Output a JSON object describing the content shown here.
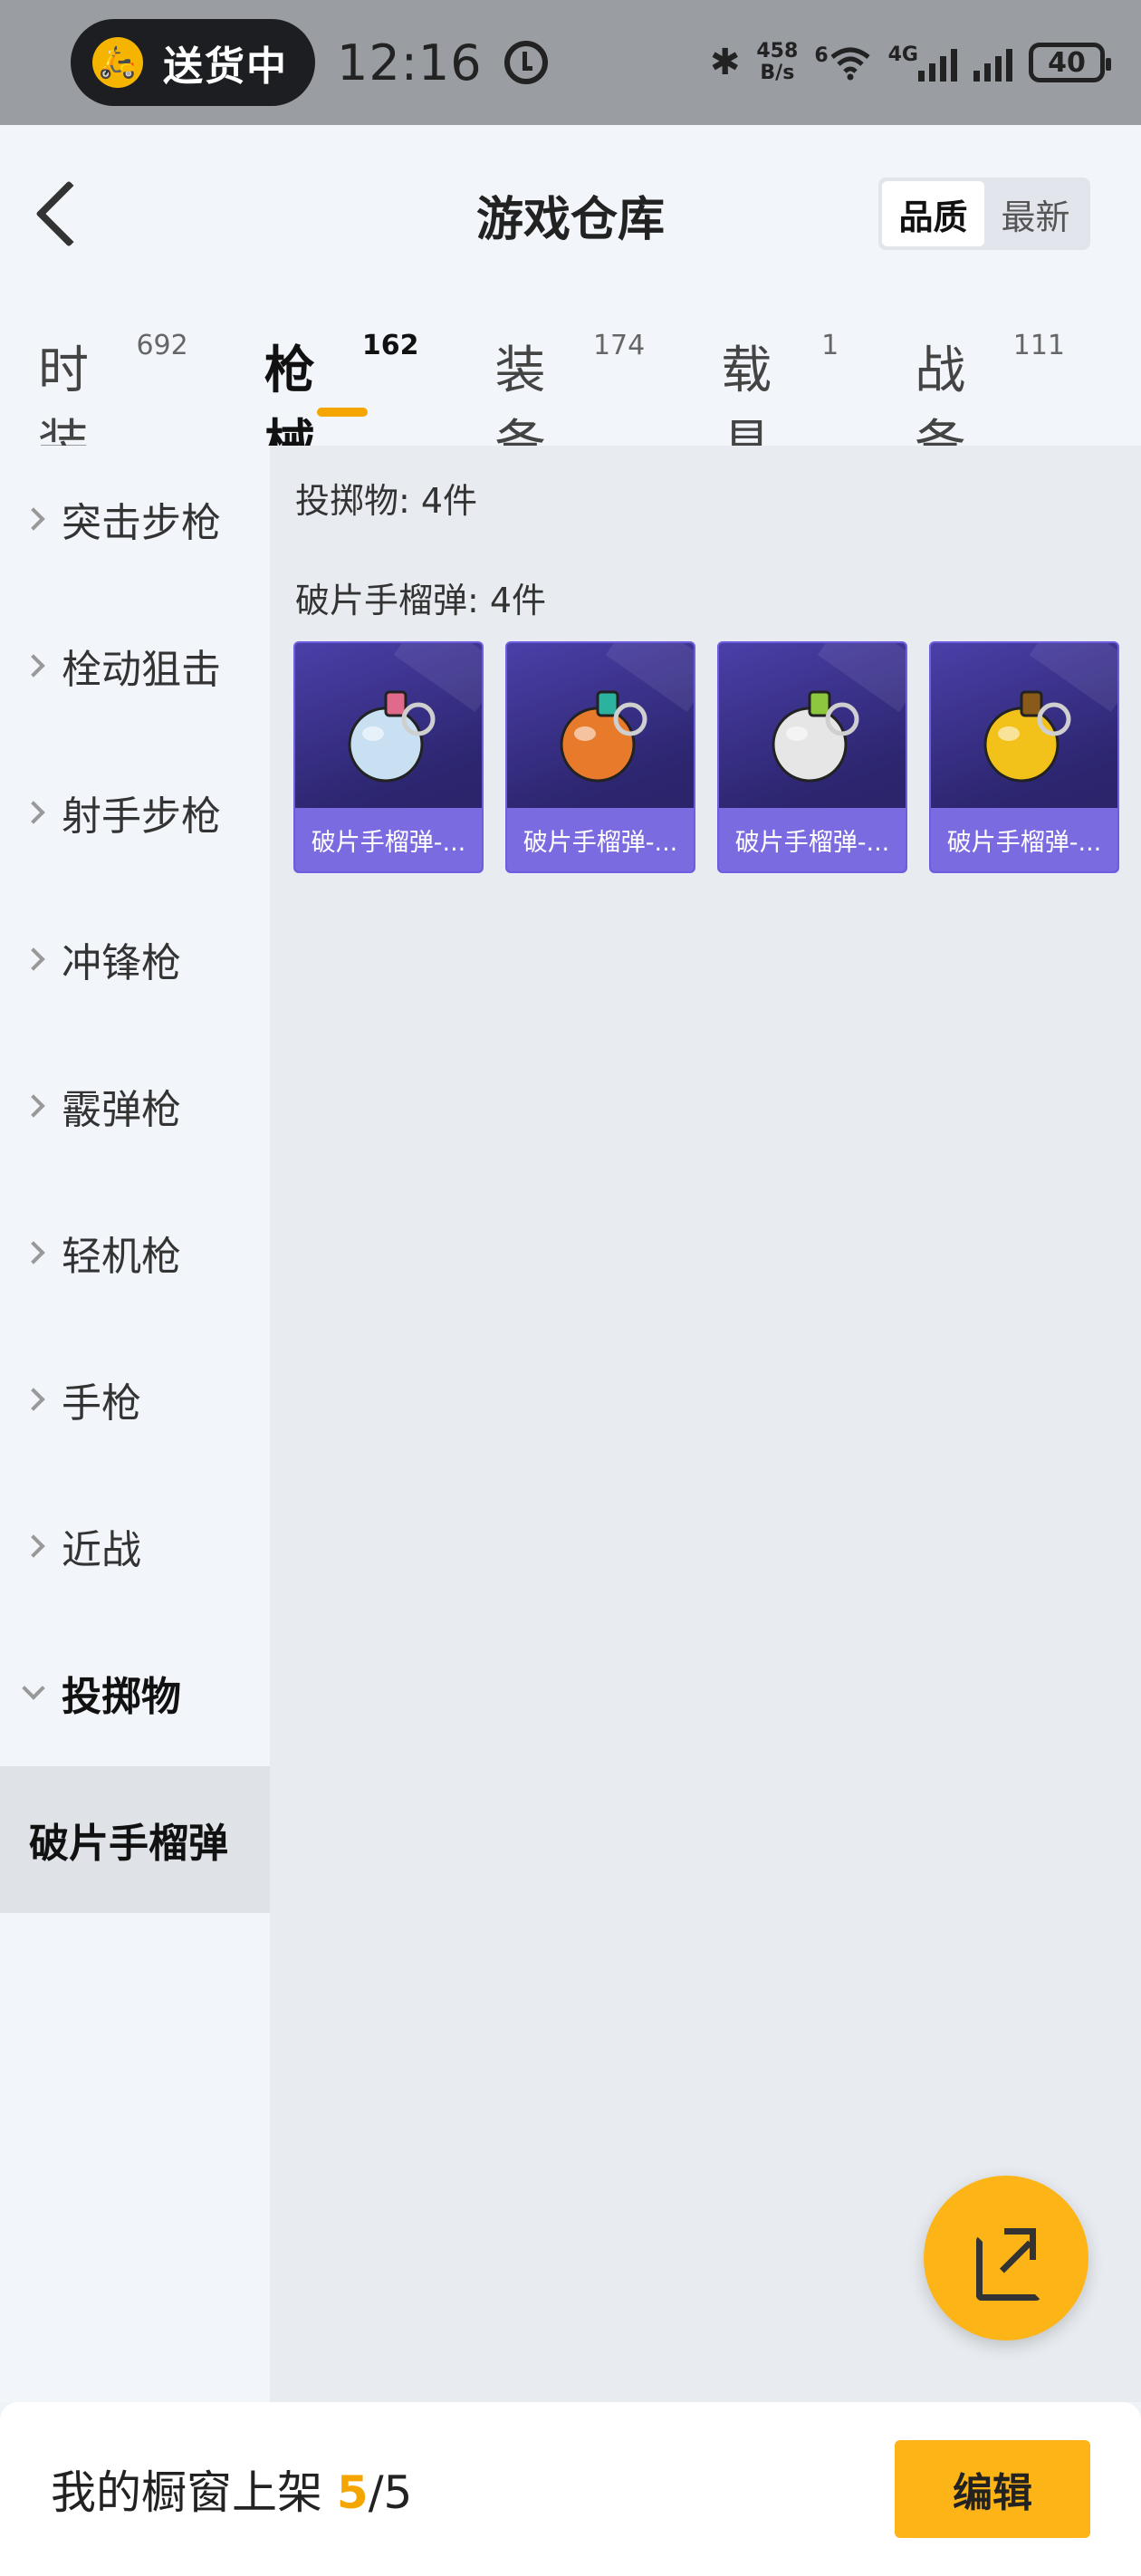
{
  "status_bar": {
    "delivery_label": "送货中",
    "time": "12:16",
    "net_speed_value": "458",
    "net_speed_unit": "B/s",
    "wifi_tag": "6",
    "network_type": "4G",
    "battery": "40"
  },
  "header": {
    "title": "游戏仓库",
    "sort_options": [
      "品质",
      "最新"
    ],
    "sort_selected": "品质"
  },
  "tabs": [
    {
      "label": "时装",
      "count": "692",
      "active": false
    },
    {
      "label": "枪械",
      "count": "162",
      "active": true
    },
    {
      "label": "装备",
      "count": "174",
      "active": false
    },
    {
      "label": "载具",
      "count": "1",
      "active": false
    },
    {
      "label": "战备",
      "count": "111",
      "active": false
    }
  ],
  "sidebar": {
    "items": [
      {
        "label": "突击步枪"
      },
      {
        "label": "栓动狙击"
      },
      {
        "label": "射手步枪"
      },
      {
        "label": "冲锋枪"
      },
      {
        "label": "霰弹枪"
      },
      {
        "label": "轻机枪"
      },
      {
        "label": "手枪"
      },
      {
        "label": "近战"
      },
      {
        "label": "投掷物"
      }
    ],
    "selected_sub": "破片手榴弹"
  },
  "main": {
    "group_title": "投掷物: 4件",
    "sub_title": "破片手榴弹: 4件",
    "cards": [
      {
        "caption": "破片手榴弹-...",
        "body_color": "#c9dff2",
        "accent_color": "#e06a8a"
      },
      {
        "caption": "破片手榴弹-...",
        "body_color": "#e87a2b",
        "accent_color": "#2bb3a0"
      },
      {
        "caption": "破片手榴弹-...",
        "body_color": "#e6e6e6",
        "accent_color": "#8dc63f"
      },
      {
        "caption": "破片手榴弹-...",
        "body_color": "#f2c21b",
        "accent_color": "#8a5a1a"
      }
    ]
  },
  "bottom_bar": {
    "shelf_label": "我的橱窗上架",
    "shelf_current": "5",
    "shelf_total": "/5",
    "edit_label": "编辑"
  },
  "colors": {
    "accent": "#fdb417",
    "card_bg": "#2d2670",
    "card_caption": "#7a6ce0"
  }
}
